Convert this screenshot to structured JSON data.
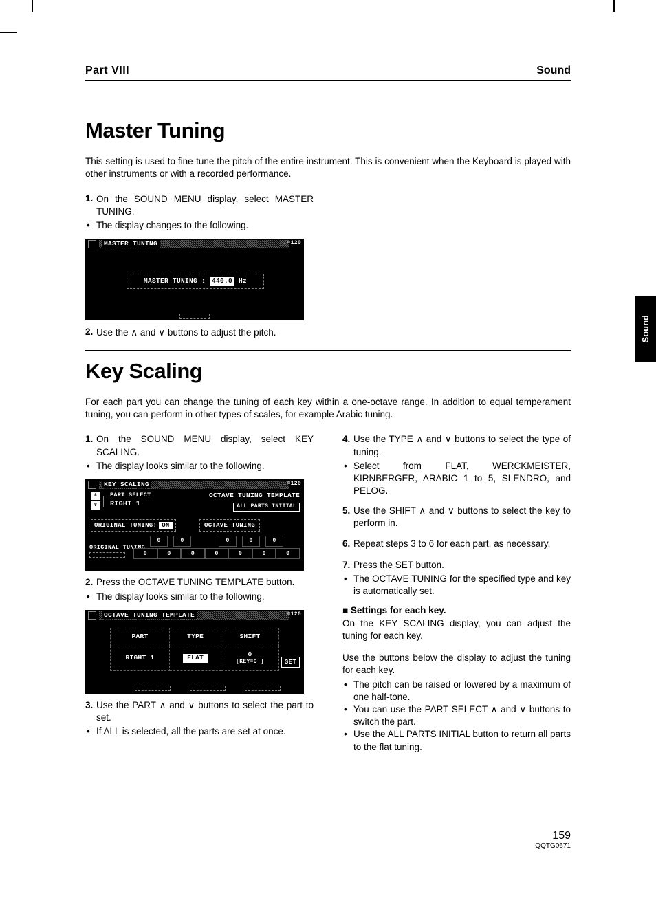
{
  "header": {
    "part": "Part VIII",
    "section": "Sound"
  },
  "side_tab": "Sound",
  "master_tuning": {
    "title": "Master Tuning",
    "intro": "This setting is used to fine-tune the pitch of the entire instrument. This is convenient when the Keyboard is played with other instruments or with a recorded performance.",
    "step1_num": "1.",
    "step1": "On the SOUND MENU display, select MASTER TUNING.",
    "step1_bullet": "The display changes to the following.",
    "lcd": {
      "title": "MASTER TUNING",
      "tempo": "♩=120",
      "label": "MASTER TUNING :",
      "value": "440.0",
      "unit": "Hz"
    },
    "step2_num": "2.",
    "step2_pre": "Use the ",
    "step2_and": " and ",
    "step2_post": " buttons to adjust the pitch."
  },
  "key_scaling": {
    "title": "Key Scaling",
    "intro": "For each part you can change the tuning of each key within a one-octave range. In addition to equal temperament tuning, you can perform in other types of scales, for example Arabic tuning.",
    "left": {
      "s1n": "1.",
      "s1": "On the SOUND MENU display, select KEY SCALING.",
      "s1b": "The display looks similar to the following.",
      "lcd2": {
        "title": "KEY SCALING",
        "tempo": "♩=120",
        "part_select": "PART SELECT",
        "right1": "RIGHT 1",
        "ott": "OCTAVE TUNING TEMPLATE",
        "api": "ALL PARTS INITIAL",
        "orig_tune": "ORIGINAL TUNING:",
        "on": "ON",
        "oct_tune": "OCTAVE TUNING",
        "orig_label": "ORIGINAL TUNING",
        "key_vals_black": [
          "0",
          "0",
          "",
          "0",
          "0",
          "0"
        ],
        "key_vals_white": [
          "0",
          "0",
          "0",
          "0",
          "0",
          "0",
          "0"
        ]
      },
      "s2n": "2.",
      "s2": "Press the OCTAVE TUNING TEMPLATE button.",
      "s2b": "The display looks similar to the following.",
      "lcd3": {
        "title": "OCTAVE TUNING TEMPLATE",
        "tempo": "♩=120",
        "h_part": "PART",
        "h_type": "TYPE",
        "h_shift": "SHIFT",
        "v_part": "RIGHT 1",
        "v_type": "FLAT",
        "v_shift_top": "0",
        "v_shift_bot": "[KEY=C ]",
        "set": "SET"
      },
      "s3n": "3.",
      "s3pre": "Use the PART ",
      "s3and": " and ",
      "s3post": " buttons to select the part to set.",
      "s3b": "If ALL is selected, all the parts are set at once."
    },
    "right": {
      "s4n": "4.",
      "s4pre": "Use the TYPE ",
      "s4and": " and ",
      "s4post": " buttons to select the type of tuning.",
      "s4b": "Select from FLAT, WERCKMEISTER, KIRNBERGER, ARABIC 1 to 5, SLENDRO, and PELOG.",
      "s5n": "5.",
      "s5pre": "Use the SHIFT ",
      "s5and": " and ",
      "s5post": " buttons to select the key to perform in.",
      "s6n": "6.",
      "s6": "Repeat steps 3 to 6 for each part, as necessary.",
      "s7n": "7.",
      "s7": "Press the SET button.",
      "s7b": "The OCTAVE TUNING for the specified type and key is automatically set.",
      "sub": "Settings for each key.",
      "p1": "On the KEY SCALING display, you can adjust the tuning for each key.",
      "p2": "Use the buttons below the display to adjust the tuning for each key.",
      "b1": "The pitch can be raised or lowered by a maximum of one half-tone.",
      "b2pre": "You can use the PART SELECT ",
      "b2and": " and ",
      "b2post": " buttons to switch the part.",
      "b3": "Use the ALL PARTS INITIAL button to return all parts to the flat tuning."
    }
  },
  "footer": {
    "page": "159",
    "code": "QQTG0671"
  },
  "glyphs": {
    "up": "∧",
    "down": "∨"
  }
}
